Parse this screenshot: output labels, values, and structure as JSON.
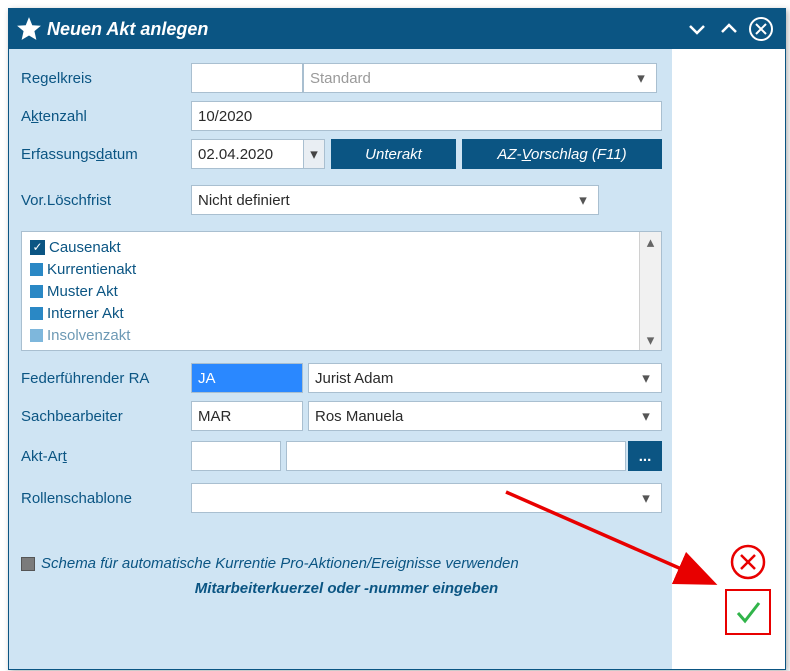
{
  "header": {
    "title": "Neuen Akt anlegen"
  },
  "form": {
    "regelkreis": {
      "label": "Regelkreis",
      "code": "",
      "value": "Standard"
    },
    "aktenzahl": {
      "label_pre": "A",
      "label_u": "k",
      "label_post": "tenzahl",
      "value": "10/2020"
    },
    "erfdatum": {
      "label_pre": "Erfassungs",
      "label_u": "d",
      "label_post": "atum",
      "value": "02.04.2020"
    },
    "unterakt_btn": "Unterakt",
    "azvorschlag_pre": "AZ-",
    "azvorschlag_u": "V",
    "azvorschlag_post": "orschlag (F11)",
    "loeschfrist": {
      "label": "Vor.Löschfrist",
      "value": "Nicht definiert"
    },
    "listbox": {
      "item0": "Causenakt",
      "item1": "Kurrentienakt",
      "item2": "Muster Akt",
      "item3": "Interner Akt",
      "item4": "Insolvenzakt"
    },
    "federraw": {
      "label": "Federführender RA",
      "code": "JA",
      "value": "Jurist Adam"
    },
    "sachb": {
      "label": "Sachbearbeiter",
      "code": "MAR",
      "value": "Ros Manuela"
    },
    "aktart": {
      "label_pre": "Akt-Ar",
      "label_u": "t",
      "code": "",
      "value": "",
      "more": "..."
    },
    "rollen": {
      "label": "Rollenschablone",
      "value": ""
    },
    "schema": "Schema für automatische Kurrentie Pro-Aktionen/Ereignisse verwenden",
    "hint": "Mitarbeiterkuerzel oder -nummer eingeben"
  }
}
